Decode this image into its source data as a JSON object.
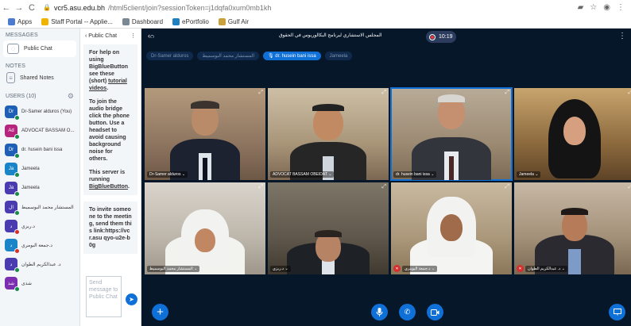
{
  "browser": {
    "back": "←",
    "forward": "→",
    "reload": "C",
    "url_host": "vcr5.asu.edu.bh",
    "url_path": "/html5client/join?sessionToken=j1dqfa0xum0mb1kh",
    "bookmarks": [
      {
        "label": "Apps",
        "color": "#4a7bd0"
      },
      {
        "label": "Staff Portal -- Applie...",
        "color": "#f0b400"
      },
      {
        "label": "Dashboard",
        "color": "#7a8894"
      },
      {
        "label": "ePortfolio",
        "color": "#1f7fbf"
      },
      {
        "label": "Gulf Air",
        "color": "#caa03c"
      }
    ]
  },
  "sidebar": {
    "messages_title": "MESSAGES",
    "public_chat": "Public Chat",
    "notes_title": "NOTES",
    "shared_notes": "Shared Notes",
    "users_title": "USERS (10)",
    "users": [
      {
        "initials": "Dr",
        "name": "Dr-Samer alduros (You)",
        "color": "#1f5fb5",
        "status": "green"
      },
      {
        "initials": "Ad",
        "name": "ADVOCAT BASSAM O...",
        "color": "#b5247d",
        "status": "green"
      },
      {
        "initials": "Dr",
        "name": "dr. husein bani issa",
        "color": "#1f5fb5",
        "status": "green"
      },
      {
        "initials": "Ja",
        "name": "Jameela",
        "color": "#1a84c9",
        "status": "green"
      },
      {
        "initials": "Ja",
        "name": "Jameela",
        "color": "#4a3bb0",
        "status": "green"
      },
      {
        "initials": "ال",
        "name": "المستشار محمد البوسميط",
        "color": "#4a3bb0",
        "status": "green"
      },
      {
        "initials": "د",
        "name": "د.ربزي",
        "color": "#4a3bb0",
        "status": "red"
      },
      {
        "initials": "د",
        "name": "د.جمعة البومري",
        "color": "#1a84c9",
        "status": "red"
      },
      {
        "initials": "د",
        "name": "د. عبدالكريم الطوان",
        "color": "#4a3bb0",
        "status": "green"
      },
      {
        "initials": "شذ",
        "name": "شذى",
        "color": "#7b2fb0",
        "status": "green"
      }
    ]
  },
  "chat": {
    "back_label": "‹  Public Chat",
    "welcome_1": "For help on using BigBlueButton see these (short)",
    "welcome_link": "tutorial videos",
    "welcome_2": "To join the audio bridge click the phone button. Use a headset to avoid causing background noise for others.",
    "welcome_3": "This server is running",
    "welcome_server": "BigBlueButton",
    "invite": "To invite someone to the meeting, send them this link:https://vcr.asu qyo-u2e-b0g",
    "input_placeholder": "Send message to Public Chat"
  },
  "main": {
    "meeting_title": "المجلس الاستشاري لبرنامج البكالوريوس في الحقوق",
    "timer": "10:19",
    "talkers": [
      {
        "label": "Dr-Samer alduros",
        "active": false
      },
      {
        "label": "المستشار محمد البوسميط",
        "active": false
      },
      {
        "label": "🎙 dr. husein bani issa",
        "active": true
      },
      {
        "label": "Jameela",
        "active": false
      }
    ],
    "tiles": [
      {
        "name": "Dr-Samer alduros ⌄",
        "muted": false,
        "speaking": false
      },
      {
        "name": "ADVOCAT BASSAM OBEIDAT ⌄",
        "muted": false,
        "speaking": false
      },
      {
        "name": "dr. husein bani issa ⌄",
        "muted": false,
        "speaking": true
      },
      {
        "name": "Jameela ⌄",
        "muted": false,
        "speaking": false
      },
      {
        "name": "المستشار محمد البوسميط ⌄",
        "muted": false,
        "speaking": false
      },
      {
        "name": "د.ربزي ⌄",
        "muted": false,
        "speaking": false
      },
      {
        "name": "د.جمعة البومري ⌄",
        "muted": true,
        "speaking": false
      },
      {
        "name": "د. عبدالكريم الطوان ⌄",
        "muted": true,
        "speaking": false
      }
    ]
  },
  "icons": {
    "mic": "🎙",
    "phone": "✆",
    "camera": "▭",
    "plus": "+",
    "present": "▭",
    "expand": "⤢",
    "send": "➤",
    "kebab": "⋮",
    "gear": "⚙"
  },
  "colors": {
    "accent": "#0f70d7",
    "panel": "#06172a",
    "muted": "#d62d2d",
    "online": "#1a8a4a"
  }
}
